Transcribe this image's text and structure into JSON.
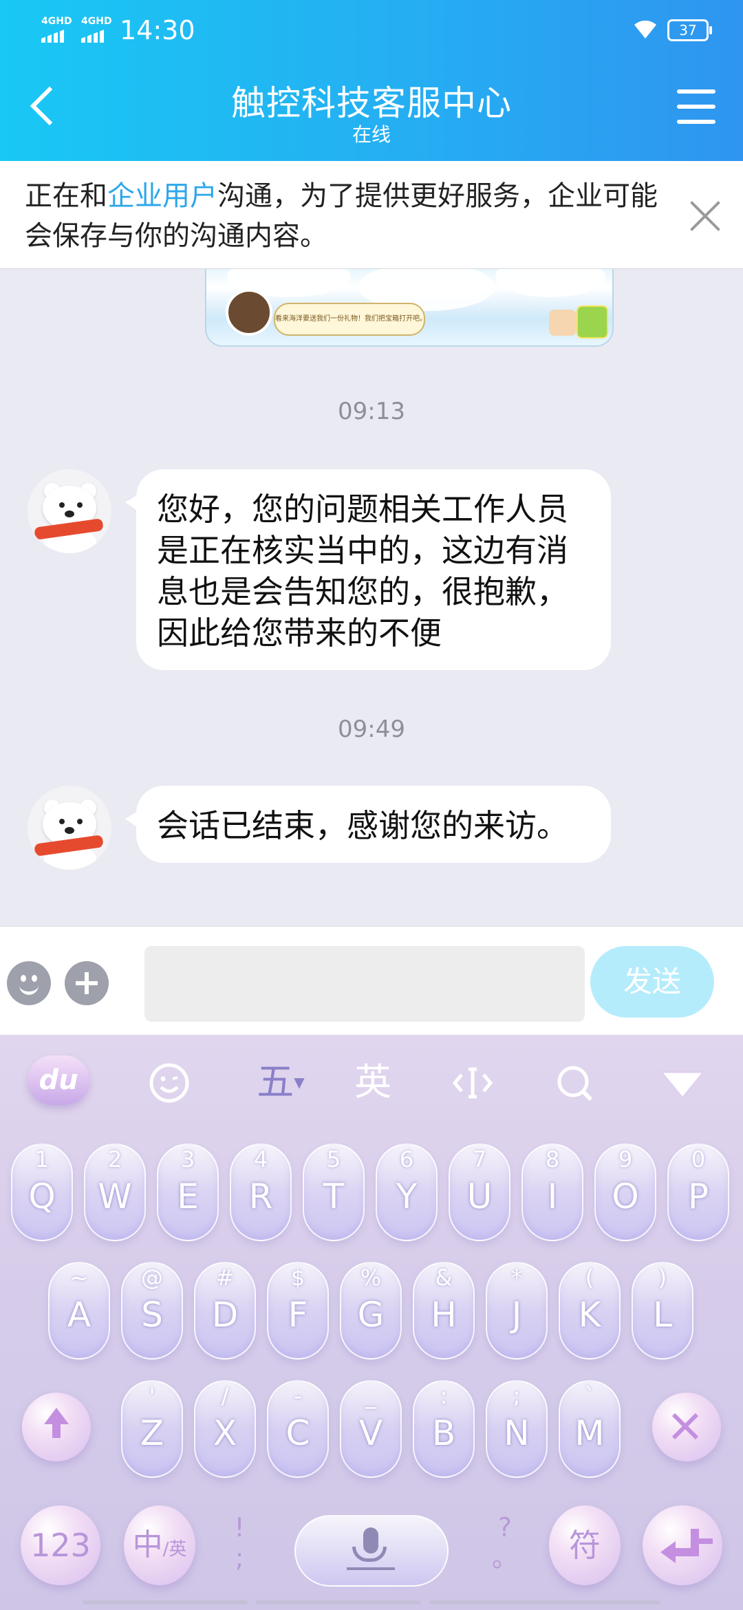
{
  "status_bar": {
    "signal1": "4GHD",
    "signal2": "4GHD",
    "time": "14:30",
    "battery": "37"
  },
  "header": {
    "title": "触控科技客服中心",
    "subtitle": "在线"
  },
  "notice": {
    "prefix": "正在和",
    "highlight": "企业用户",
    "suffix": "沟通，为了提供更好服务，企业可能会保存与你的沟通内容。"
  },
  "image_message": {
    "caption": "看来海洋要送我们一份礼物！我们把宝箱打开吧。"
  },
  "messages": [
    {
      "time": "09:13",
      "text": "您好，您的问题相关工作人员是正在核实当中的，这边有消息也是会告知您的，很抱歉，因此给您带来的不便"
    },
    {
      "time": "09:49",
      "text": "会话已结束，感谢您的来访。"
    }
  ],
  "input_bar": {
    "placeholder": "",
    "send_label": "发送"
  },
  "keyboard": {
    "toolbar": {
      "logo": "du",
      "wubi": "五",
      "english": "英"
    },
    "row1": [
      {
        "sub": "1",
        "main": "Q"
      },
      {
        "sub": "2",
        "main": "W"
      },
      {
        "sub": "3",
        "main": "E"
      },
      {
        "sub": "4",
        "main": "R"
      },
      {
        "sub": "5",
        "main": "T"
      },
      {
        "sub": "6",
        "main": "Y"
      },
      {
        "sub": "7",
        "main": "U"
      },
      {
        "sub": "8",
        "main": "I"
      },
      {
        "sub": "9",
        "main": "O"
      },
      {
        "sub": "0",
        "main": "P"
      }
    ],
    "row2": [
      {
        "sub": "~",
        "main": "A"
      },
      {
        "sub": "@",
        "main": "S"
      },
      {
        "sub": "#",
        "main": "D"
      },
      {
        "sub": "$",
        "main": "F"
      },
      {
        "sub": "%",
        "main": "G"
      },
      {
        "sub": "&",
        "main": "H"
      },
      {
        "sub": "*",
        "main": "J"
      },
      {
        "sub": "(",
        "main": "K"
      },
      {
        "sub": ")",
        "main": "L"
      }
    ],
    "row3": [
      {
        "sub": "'",
        "main": "Z"
      },
      {
        "sub": "/",
        "main": "X"
      },
      {
        "sub": "-",
        "main": "C"
      },
      {
        "sub": "_",
        "main": "V"
      },
      {
        "sub": ":",
        "main": "B"
      },
      {
        "sub": ";",
        "main": "N"
      },
      {
        "sub": "`",
        "main": "M"
      }
    ],
    "num_label": "123",
    "lang_main": "中",
    "lang_sub": "/英",
    "punct_left_top": "!",
    "punct_left_bottom": ";",
    "punct_right_top": "?",
    "punct_right_bottom": "。",
    "symbol_label": "符"
  }
}
